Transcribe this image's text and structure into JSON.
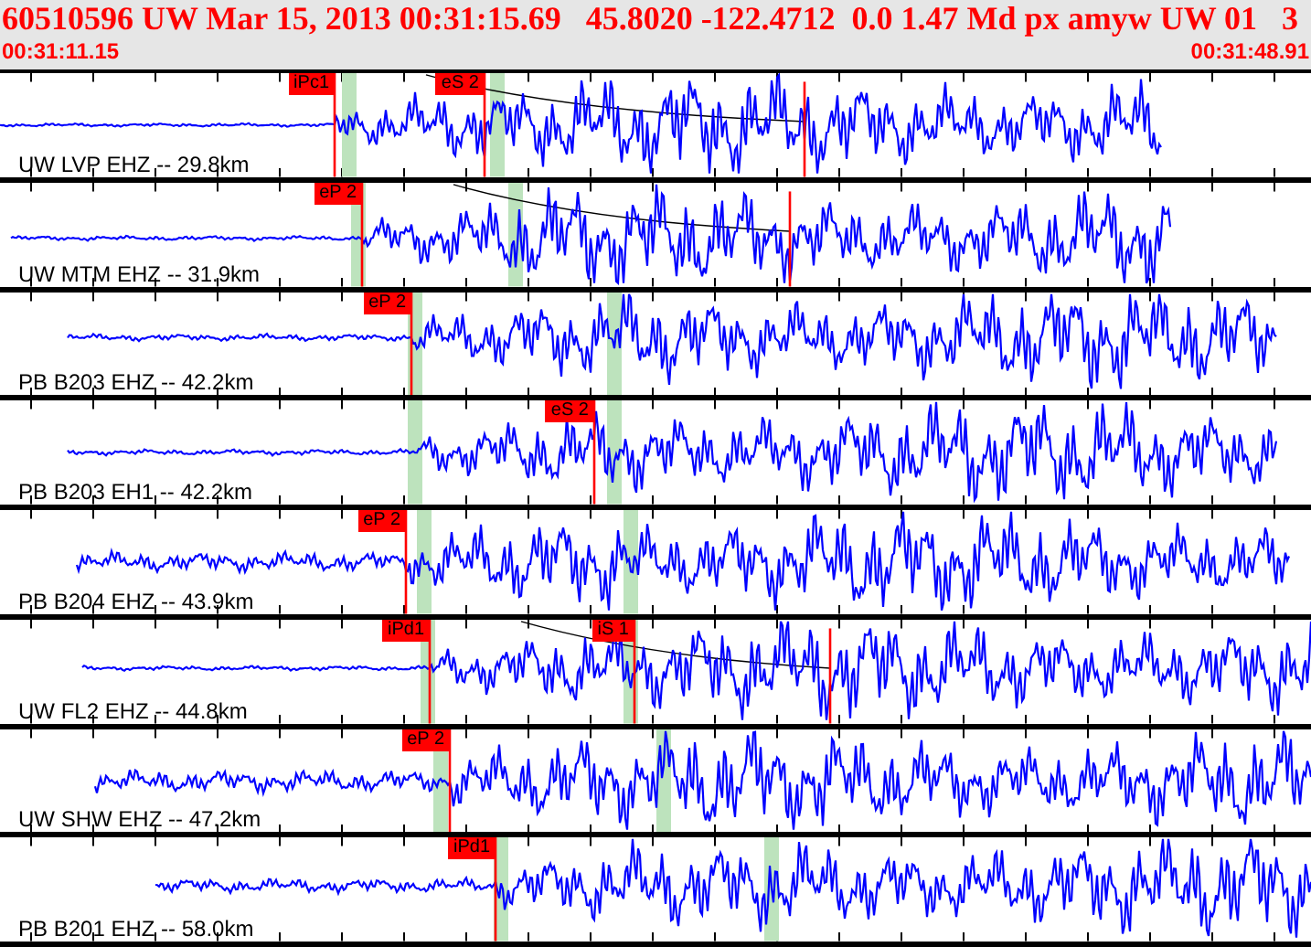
{
  "header": {
    "title": "60510596 UW Mar 15, 2013 00:31:15.69   45.8020 -122.4712  0.0 1.47 Md px amyw UW 01   3",
    "start_time": "00:31:11.15",
    "end_time": "00:31:48.91"
  },
  "traces": [
    {
      "label": "UW LVP EHZ -- 29.8km",
      "picks": [
        {
          "label": "iPc1"
        },
        {
          "label": "eS 2"
        }
      ]
    },
    {
      "label": "UW MTM EHZ -- 31.9km",
      "picks": [
        {
          "label": "eP 2"
        }
      ]
    },
    {
      "label": "PB B203 EHZ -- 42.2km",
      "picks": [
        {
          "label": "eP 2"
        }
      ]
    },
    {
      "label": "PB B203 EH1 -- 42.2km",
      "picks": [
        {
          "label": "eS 2"
        }
      ]
    },
    {
      "label": "PB B204 EHZ -- 43.9km",
      "picks": [
        {
          "label": "eP 2"
        }
      ]
    },
    {
      "label": "UW FL2 EHZ -- 44.8km",
      "picks": [
        {
          "label": "iPd1"
        },
        {
          "label": "iS 1"
        }
      ]
    },
    {
      "label": "UW SHW EHZ -- 47.2km",
      "picks": [
        {
          "label": "eP 2"
        }
      ]
    },
    {
      "label": "PB B201 EHZ -- 58.0km",
      "picks": [
        {
          "label": "iPd1"
        }
      ]
    }
  ]
}
